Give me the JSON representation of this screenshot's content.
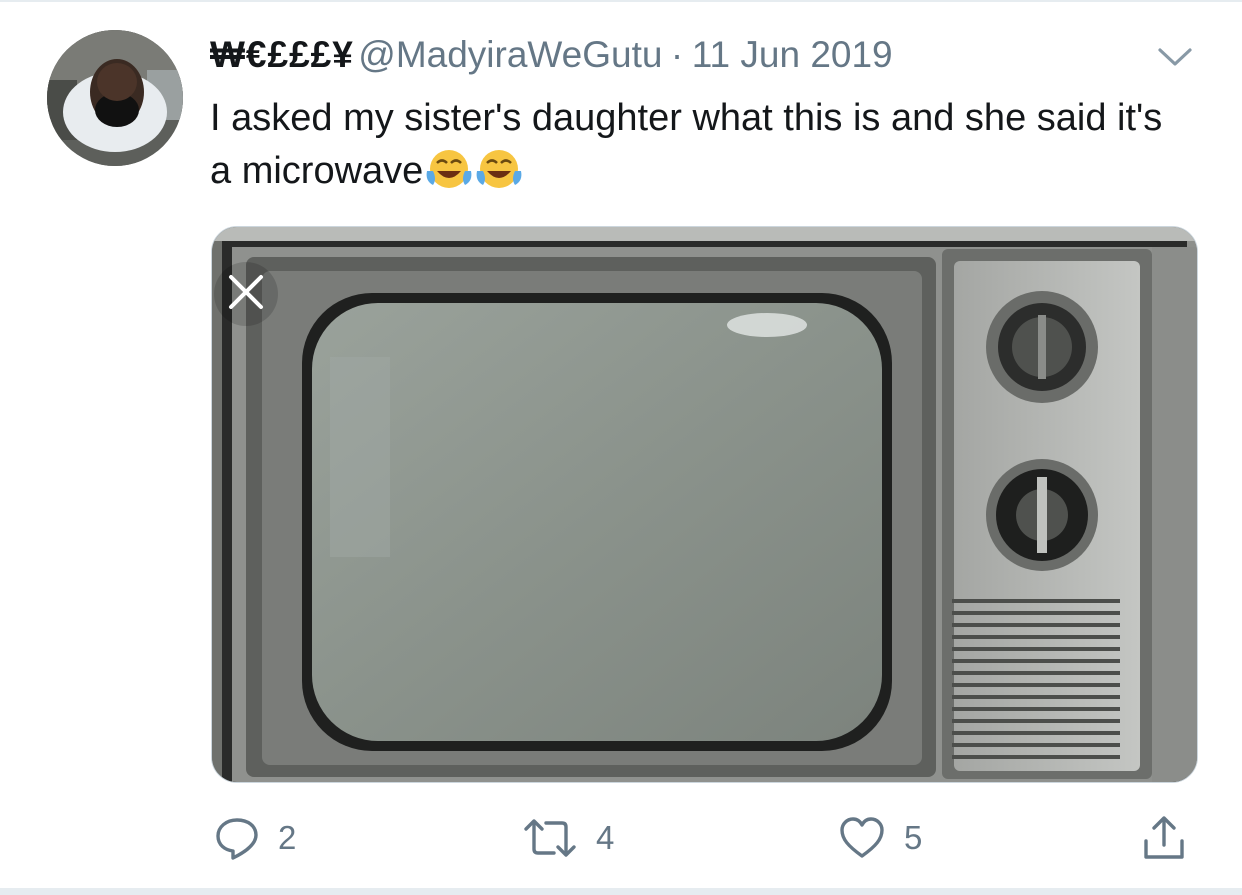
{
  "tweet": {
    "display_name": "₩€£££¥",
    "handle": "@MadyiraWeGutu",
    "separator": "·",
    "date": "11 Jun 2019",
    "text": "I asked my sister's daughter what this is and she said it's a microwave",
    "emojis": [
      "face-with-tears-of-joy",
      "face-with-tears-of-joy"
    ],
    "media_description_icon": "tv-photo"
  },
  "actions": {
    "reply_count": "2",
    "retweet_count": "4",
    "like_count": "5"
  },
  "icons": {
    "menu": "chevron-down-icon",
    "reply": "comment-bubble-icon",
    "retweet": "retweet-arrows-icon",
    "like": "heart-icon",
    "share": "share-upload-icon",
    "close": "close-icon"
  },
  "colors": {
    "text_primary": "#14171a",
    "text_secondary": "#657786",
    "divider": "#e6ecf0"
  }
}
